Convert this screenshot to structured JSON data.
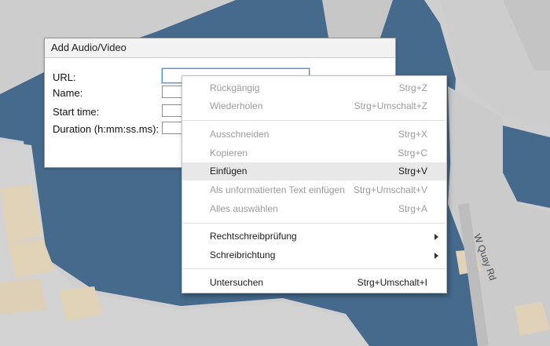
{
  "map": {
    "road_label": "W Quay Rd",
    "colors": {
      "water": "#456a8c",
      "land": "#cfcfcf",
      "building": "#e1d3b8"
    }
  },
  "dialog": {
    "title": "Add Audio/Video",
    "fields": {
      "url_label": "URL:",
      "name_label": "Name:",
      "start_label": "Start time:",
      "duration_label": "Duration (h:mm:ss.ms):"
    }
  },
  "context_menu": {
    "items": [
      {
        "label": "Rückgängig",
        "shortcut": "Strg+Z"
      },
      {
        "label": "Wiederholen",
        "shortcut": "Strg+Umschalt+Z"
      },
      {
        "label": "Ausschneiden",
        "shortcut": "Strg+X"
      },
      {
        "label": "Kopieren",
        "shortcut": "Strg+C"
      },
      {
        "label": "Einfügen",
        "shortcut": "Strg+V"
      },
      {
        "label": "Als unformatierten Text einfügen",
        "shortcut": "Strg+Umschalt+V"
      },
      {
        "label": "Alles auswählen",
        "shortcut": "Strg+A"
      },
      {
        "label": "Rechtschreibprüfung",
        "shortcut": ""
      },
      {
        "label": "Schreibrichtung",
        "shortcut": ""
      },
      {
        "label": "Untersuchen",
        "shortcut": "Strg+Umschalt+I"
      }
    ]
  }
}
